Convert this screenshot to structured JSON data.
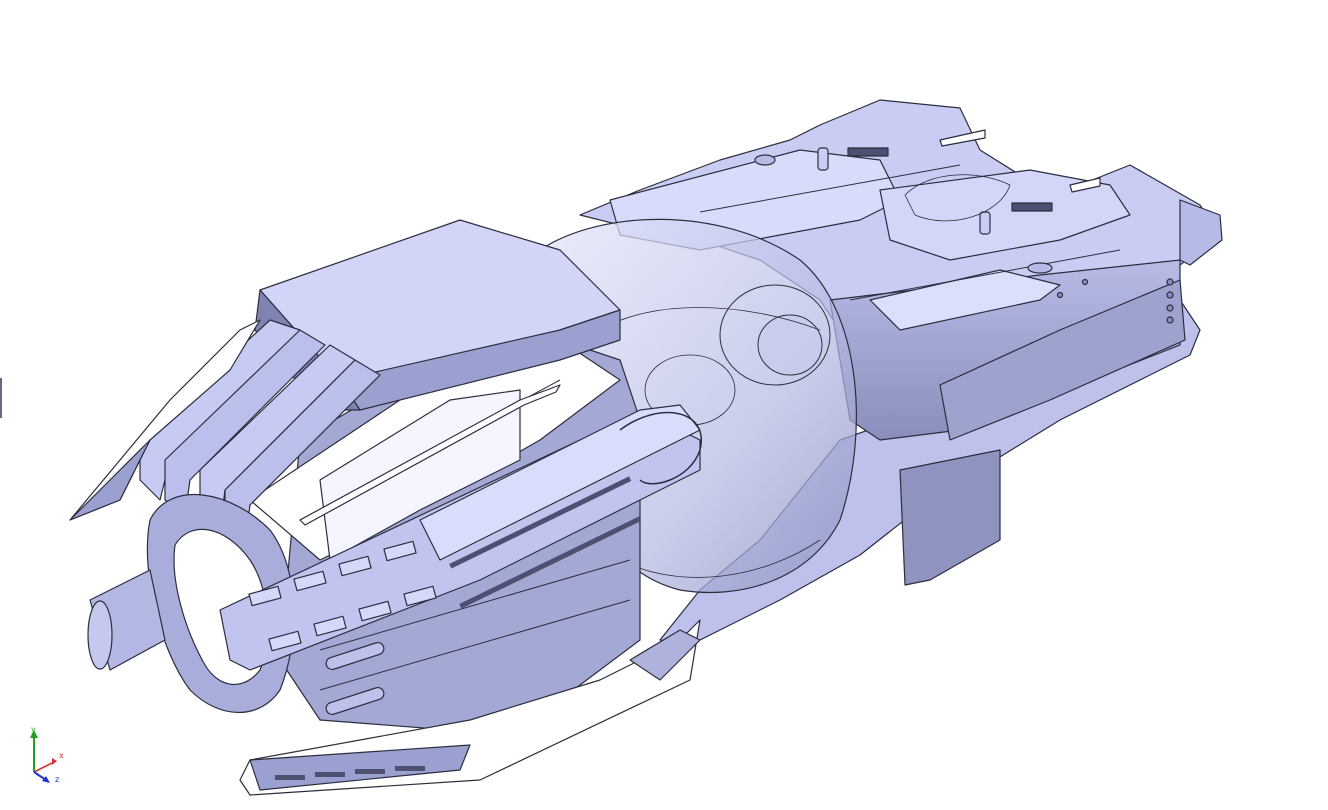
{
  "viewport": {
    "background": "#ffffff",
    "model_colors": {
      "base": "#c8ccf2",
      "light": "#dcdffa",
      "mid": "#aeb2dd",
      "dark": "#8e92bd",
      "edge": "#2c2e3e",
      "glass": "#b8bde6"
    }
  },
  "triad": {
    "x_label": "x",
    "y_label": "y",
    "z_label": "z",
    "x_color": "#d23232",
    "y_color": "#22a022",
    "z_color": "#2232c8"
  }
}
